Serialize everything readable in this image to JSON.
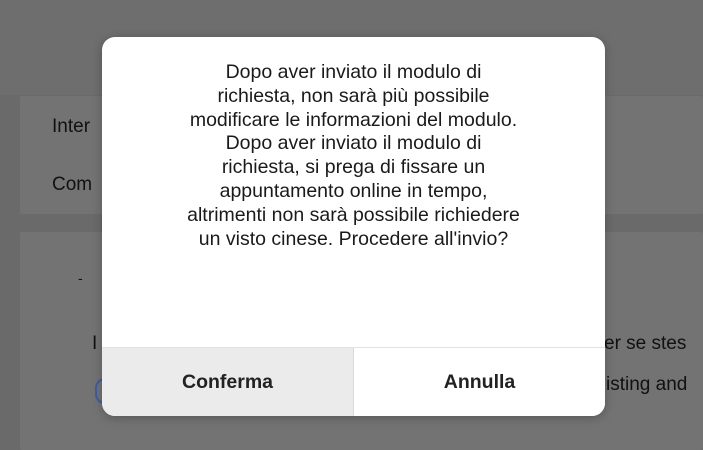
{
  "background": {
    "card1": {
      "field1_partial": "Inter",
      "field2_partial": "Com"
    },
    "card2": {
      "dash_partial": "-",
      "line1_left_partial": "I",
      "line1_right_partial": "er se stes",
      "line2_right_partial": "isting and"
    }
  },
  "dialog": {
    "message": "Dopo aver inviato il modulo di\nrichiesta, non sarà più possibile\nmodificare le informazioni del modulo.\nDopo aver inviato il modulo di\nrichiesta, si prega di fissare un\nappuntamento online in tempo,\naltrimenti non sarà possibile richiedere\nun visto cinese. Procedere all'invio?",
    "confirm_label": "Conferma",
    "cancel_label": "Annulla"
  },
  "colors": {
    "overlay": "#6a6a6a",
    "modal_bg": "#ffffff",
    "confirm_bg": "#ebebeb",
    "text": "#1a1a1a"
  }
}
